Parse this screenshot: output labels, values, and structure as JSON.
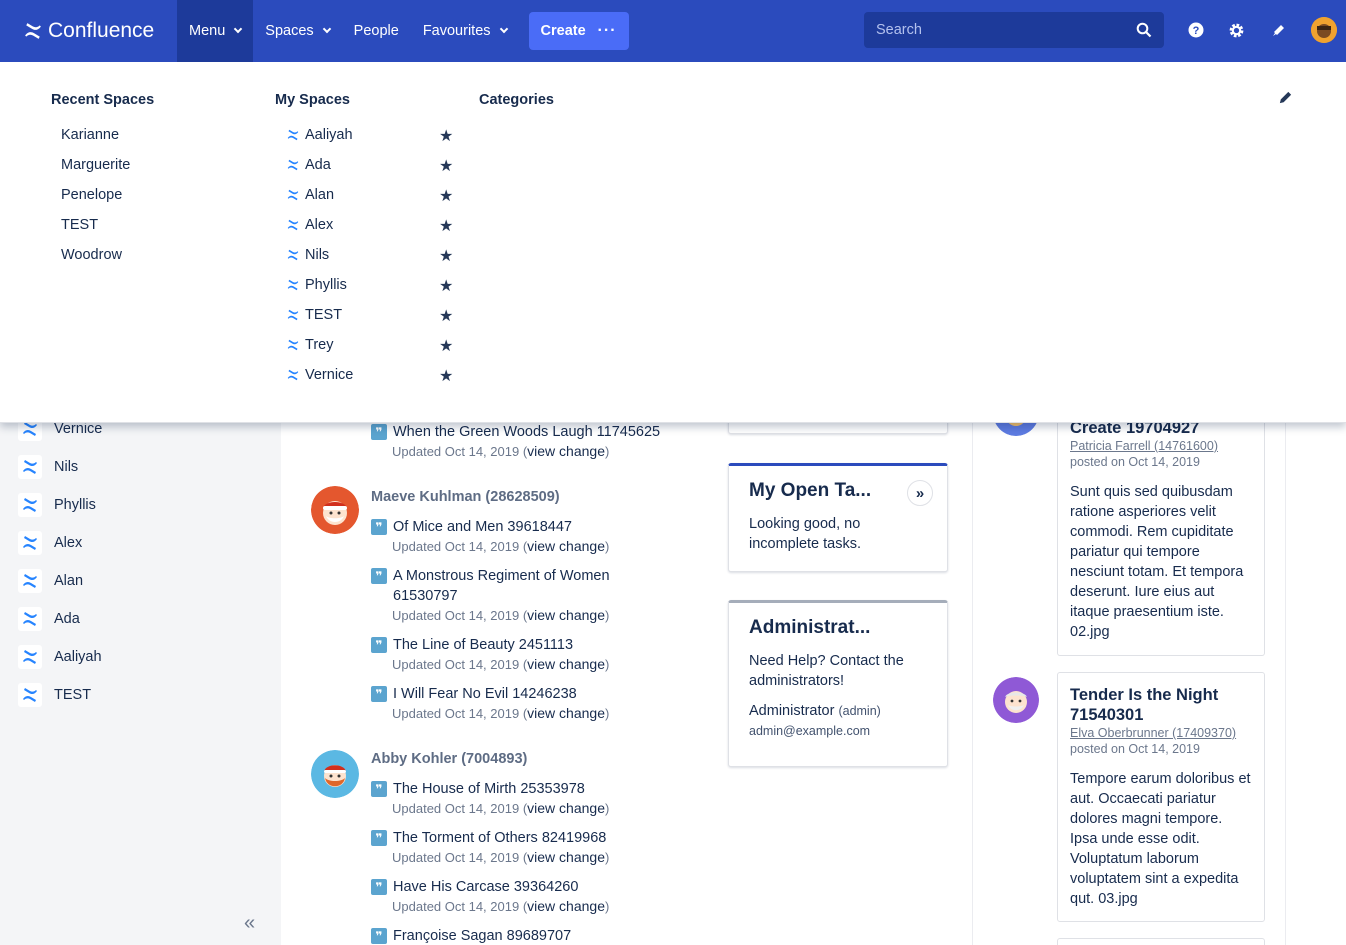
{
  "topnav": {
    "logo_text": "Confluence",
    "menu": "Menu",
    "spaces": "Spaces",
    "people": "People",
    "favourites": "Favourites",
    "create": "Create",
    "create_more": "···",
    "search_placeholder": "Search"
  },
  "dropdown": {
    "recent_heading": "Recent Spaces",
    "my_heading": "My Spaces",
    "categories_heading": "Categories",
    "recent_spaces": [
      "Karianne",
      "Marguerite",
      "Penelope",
      "TEST",
      "Woodrow"
    ],
    "my_spaces": [
      "Aaliyah",
      "Ada",
      "Alan",
      "Alex",
      "Nils",
      "Phyllis",
      "TEST",
      "Trey",
      "Vernice"
    ]
  },
  "sidebar": {
    "items": [
      "Vernice",
      "Nils",
      "Phyllis",
      "Alex",
      "Alan",
      "Ada",
      "Aaliyah",
      "TEST"
    ],
    "collapse_glyph": "«"
  },
  "feed": {
    "groups": [
      {
        "user": "",
        "items": [
          {
            "title": "When the Green Woods Laugh 11745625",
            "meta": "Updated Oct 14, 2019 (",
            "link": "view change",
            "close": ")"
          }
        ]
      },
      {
        "user": "Maeve Kuhlman (28628509)",
        "items": [
          {
            "title": "Of Mice and Men 39618447",
            "meta": "Updated Oct 14, 2019 (",
            "link": "view change",
            "close": ")"
          },
          {
            "title": "A Monstrous Regiment of Women 61530797",
            "meta": "Updated Oct 14, 2019 (",
            "link": "view change",
            "close": ")"
          },
          {
            "title": "The Line of Beauty 2451113",
            "meta": "Updated Oct 14, 2019 (",
            "link": "view change",
            "close": ")"
          },
          {
            "title": "I Will Fear No Evil 14246238",
            "meta": "Updated Oct 14, 2019 (",
            "link": "view change",
            "close": ")"
          }
        ]
      },
      {
        "user": "Abby Kohler (7004893)",
        "items": [
          {
            "title": "The House of Mirth 25353978",
            "meta": "Updated Oct 14, 2019 (",
            "link": "view change",
            "close": ")"
          },
          {
            "title": "The Torment of Others 82419968",
            "meta": "Updated Oct 14, 2019 (",
            "link": "view change",
            "close": ")"
          },
          {
            "title": "Have His Carcase 39364260",
            "meta": "Updated Oct 14, 2019 (",
            "link": "view change",
            "close": ")"
          },
          {
            "title": "Françoise Sagan 89689707",
            "meta": "",
            "link": "",
            "close": ""
          }
        ]
      }
    ]
  },
  "tasks_card": {
    "title": "My Open Ta...",
    "body": "Looking good, no incomplete tasks."
  },
  "admin_card": {
    "title": "Administrat...",
    "body": "Need Help? Contact the administrators!",
    "admin_name": "Administrator",
    "admin_user": "(admin)",
    "admin_email": "admin@example.com"
  },
  "posts": [
    {
      "title": "Create 19704927",
      "author": "Patricia Farrell (14761600)",
      "date": "posted on Oct 14, 2019",
      "body": "Sunt quis sed quibusdam ratione asperiores velit commodi. Rem cupiditate pariatur qui tempore nesciunt totam. Et tempora deserunt. Iure eius aut itaque praesentium iste. 02.jpg"
    },
    {
      "title": "Tender Is the Night 71540301",
      "author": "Elva Oberbrunner (17409370)",
      "date": "posted on Oct 14, 2019",
      "body": "Tempore earum doloribus et aut. Occaecati pariatur dolores magni tempore. Ipsa unde esse odit. Voluptatum laborum voluptatem sint a expedita qut. 03.jpg"
    }
  ],
  "colors": {
    "nav_bg": "#2b4bbd",
    "nav_active": "#1d3a9a",
    "create_btn": "#4a6cf7",
    "text": "#172b4d"
  }
}
